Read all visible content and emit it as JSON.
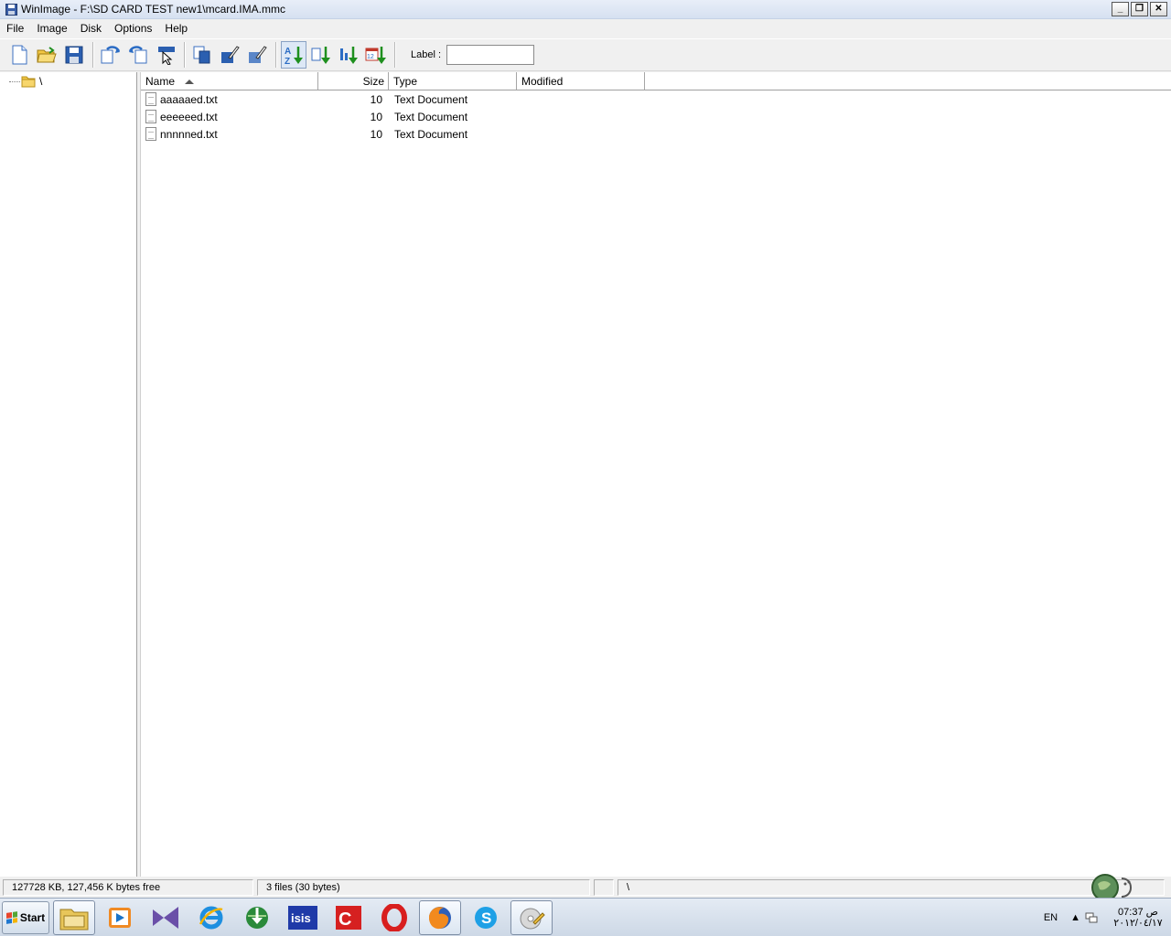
{
  "window": {
    "title": "WinImage - F:\\SD CARD TEST new1\\mcard.IMA.mmc",
    "controls": {
      "minimize": "_",
      "restore": "❐",
      "close": "✕"
    }
  },
  "menu": {
    "items": [
      "File",
      "Image",
      "Disk",
      "Options",
      "Help"
    ]
  },
  "toolbar": {
    "label_text": "Label :",
    "label_value": ""
  },
  "tree": {
    "root_label": "\\"
  },
  "list": {
    "columns": {
      "name": "Name",
      "size": "Size",
      "type": "Type",
      "modified": "Modified"
    },
    "files": [
      {
        "name": "aaaaaed.txt",
        "size": "10",
        "type": "Text Document",
        "modified": ""
      },
      {
        "name": "eeeeeed.txt",
        "size": "10",
        "type": "Text Document",
        "modified": ""
      },
      {
        "name": "nnnnned.txt",
        "size": "10",
        "type": "Text Document",
        "modified": ""
      }
    ]
  },
  "status": {
    "free": "127728 KB, 127,456 K bytes free",
    "files": "3 files (30 bytes)",
    "blank": "",
    "path": "\\"
  },
  "taskbar": {
    "start_label": "Start",
    "lang": "EN",
    "clock_time": "07:37 ص",
    "clock_date": "٢٠١٢/٠٤/١٧"
  },
  "colors": {
    "title_bar": "#d6e1f1",
    "toolbar_blue": "#2b6cc4",
    "arrow_green": "#1e8f1e",
    "taskbar": "#cdd8e6"
  }
}
